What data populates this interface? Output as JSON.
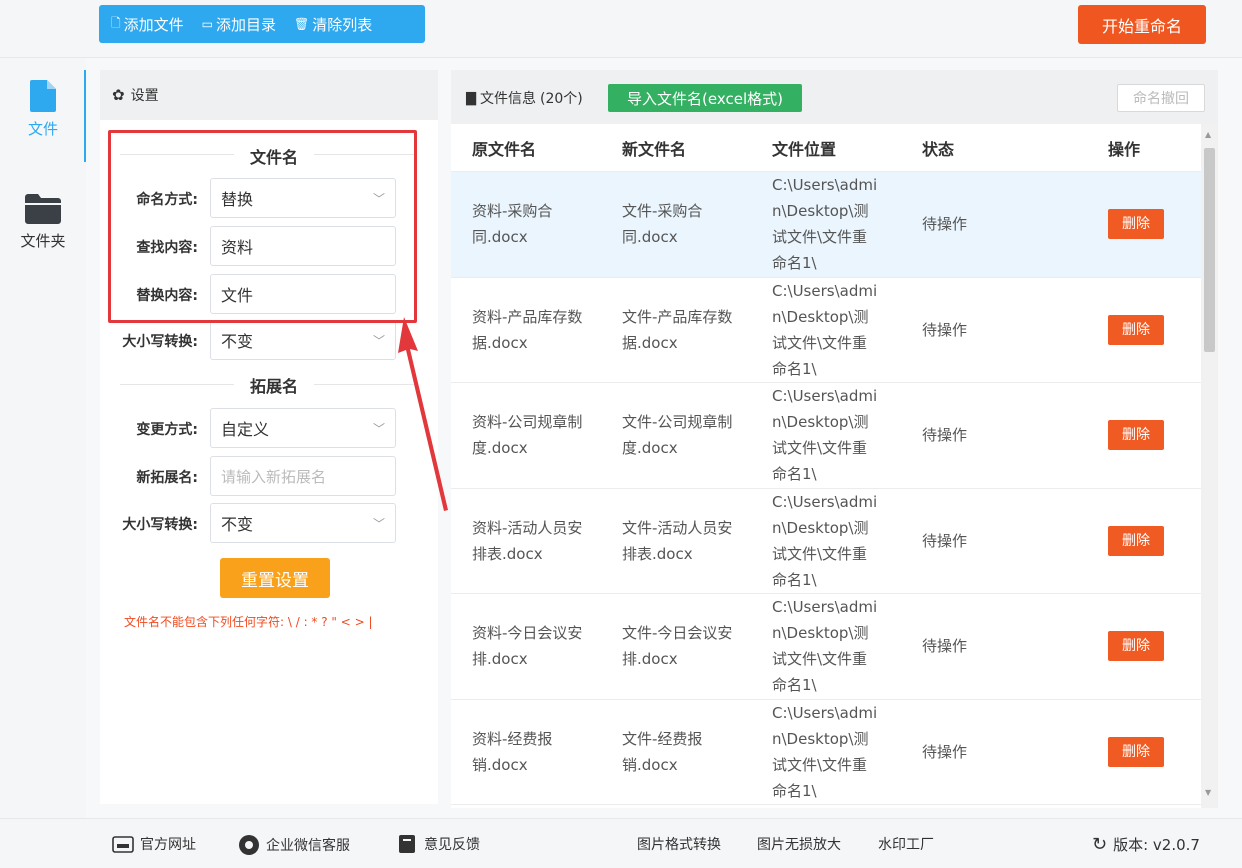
{
  "toolbar": {
    "add_file": "添加文件",
    "add_dir": "添加目录",
    "clear_list": "清除列表",
    "start": "开始重命名"
  },
  "nav": {
    "file": "文件",
    "folder": "文件夹"
  },
  "settings": {
    "header": "设置",
    "filename_section": "文件名",
    "naming_mode_label": "命名方式:",
    "naming_mode_value": "替换",
    "find_label": "查找内容:",
    "find_value": "资料",
    "replace_label": "替换内容:",
    "replace_value": "文件",
    "case_label": "大小写转换:",
    "case_value": "不变",
    "ext_section": "拓展名",
    "ext_mode_label": "变更方式:",
    "ext_mode_value": "自定义",
    "new_ext_label": "新拓展名:",
    "new_ext_placeholder": "请输入新拓展名",
    "ext_case_label": "大小写转换:",
    "ext_case_value": "不变",
    "reset": "重置设置",
    "warning": "文件名不能包含下列任何字符: \\ / : * ? \" < > |"
  },
  "files": {
    "title": "文件信息",
    "count": "(20个)",
    "import_btn": "导入文件名(excel格式)",
    "undo_btn": "命名撤回",
    "columns": [
      "原文件名",
      "新文件名",
      "文件位置",
      "状态",
      "操作"
    ],
    "rows": [
      {
        "orig": "资料-采购合同.docx",
        "new": "文件-采购合同.docx",
        "loc": "C:\\Users\\admin\\Desktop\\测试文件\\文件重命名1\\",
        "status": "待操作",
        "action": "删除"
      },
      {
        "orig": "资料-产品库存数据.docx",
        "new": "文件-产品库存数据.docx",
        "loc": "C:\\Users\\admin\\Desktop\\测试文件\\文件重命名1\\",
        "status": "待操作",
        "action": "删除"
      },
      {
        "orig": "资料-公司规章制度.docx",
        "new": "文件-公司规章制度.docx",
        "loc": "C:\\Users\\admin\\Desktop\\测试文件\\文件重命名1\\",
        "status": "待操作",
        "action": "删除"
      },
      {
        "orig": "资料-活动人员安排表.docx",
        "new": "文件-活动人员安排表.docx",
        "loc": "C:\\Users\\admin\\Desktop\\测试文件\\文件重命名1\\",
        "status": "待操作",
        "action": "删除"
      },
      {
        "orig": "资料-今日会议安排.docx",
        "new": "文件-今日会议安排.docx",
        "loc": "C:\\Users\\admin\\Desktop\\测试文件\\文件重命名1\\",
        "status": "待操作",
        "action": "删除"
      },
      {
        "orig": "资料-经费报销.docx",
        "new": "文件-经费报销.docx",
        "loc": "C:\\Users\\admin\\Desktop\\测试文件\\文件重命名1\\",
        "status": "待操作",
        "action": "删除"
      }
    ]
  },
  "footer": {
    "website": "官方网址",
    "wechat": "企业微信客服",
    "feedback": "意见反馈",
    "img_convert": "图片格式转换",
    "img_enlarge": "图片无损放大",
    "watermark": "水印工厂",
    "version": "版本: v2.0.7"
  },
  "colors": {
    "primary": "#2ea8ef",
    "danger": "#f0561f",
    "success": "#33b061",
    "warning": "#f9a11b",
    "highlight_box": "#e2373b"
  }
}
